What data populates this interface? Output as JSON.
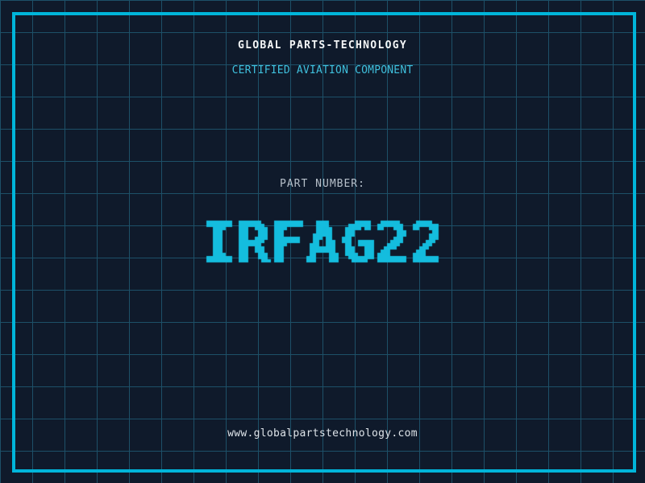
{
  "header": {
    "title": "GLOBAL PARTS-TECHNOLOGY",
    "subtitle": "CERTIFIED AVIATION COMPONENT"
  },
  "part": {
    "label": "PART NUMBER:",
    "number": "IRFAG22"
  },
  "footer": {
    "website": "www.globalpartstechnology.com"
  },
  "colors": {
    "background": "#0f1a2b",
    "grid_line": "#1d5068",
    "frame_border": "#00b5da",
    "title_text": "#f4f6f7",
    "subtitle_text": "#3fc0dd",
    "label_text": "#b7c0ca",
    "part_number_text": "#14bdde",
    "footer_text": "#dde3e8"
  }
}
